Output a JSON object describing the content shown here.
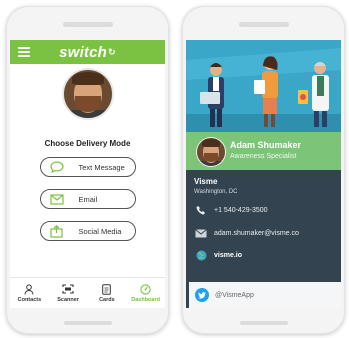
{
  "left_phone": {
    "brand": "switch",
    "section_title": "Choose Delivery Mode",
    "modes": [
      {
        "label": "Text Message",
        "icon": "chat-bubble-icon"
      },
      {
        "label": "Email",
        "icon": "envelope-icon"
      },
      {
        "label": "Social Media",
        "icon": "share-icon"
      }
    ],
    "nav": [
      {
        "label": "Contacts",
        "icon": "person-icon",
        "active": false
      },
      {
        "label": "Scanner",
        "icon": "scanner-icon",
        "active": false
      },
      {
        "label": "Cards",
        "icon": "card-icon",
        "active": false
      },
      {
        "label": "Dashboard",
        "icon": "gauge-icon",
        "active": true
      }
    ]
  },
  "right_phone": {
    "name": "Adam Shumaker",
    "role": "Awareness Specialist",
    "company": "Visme",
    "location": "Washington, DC",
    "phone": "+1 540-429-3500",
    "email": "adam.shumaker@visme.co",
    "website": "visme.io",
    "social_handle": "@VismeApp"
  },
  "colors": {
    "accent_green": "#7bc142",
    "card_green": "#7bc478",
    "info_dark": "#33434f",
    "hero_blue": "#3aa7c9",
    "twitter_blue": "#1da1f2"
  }
}
